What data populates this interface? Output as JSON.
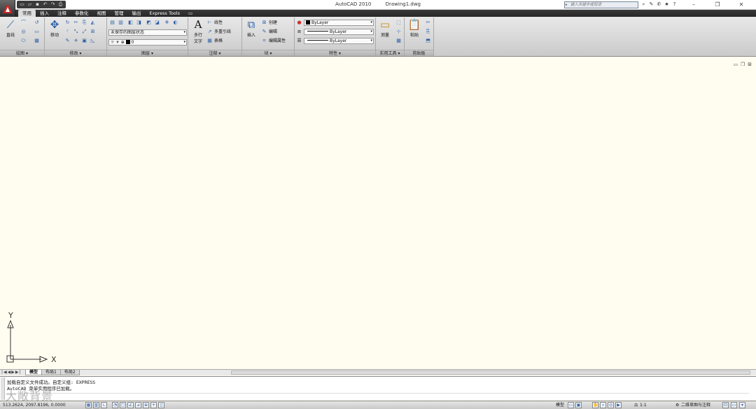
{
  "title_bar": {
    "app_name": "AutoCAD 2010",
    "document": "Drawing1.dwg",
    "search_placeholder": "键入关键字或短语",
    "qat_icons": [
      "new-icon",
      "open-icon",
      "save-icon",
      "undo-icon",
      "redo-icon",
      "plot-icon"
    ],
    "window_controls": [
      "minimize-icon",
      "restore-icon",
      "close-icon"
    ]
  },
  "ribbon_tabs": [
    "常用",
    "插入",
    "注释",
    "参数化",
    "视图",
    "管理",
    "输出",
    "Express Tools"
  ],
  "ribbon": {
    "draw": {
      "title": "绘图 ▾",
      "line_label": "直线"
    },
    "modify": {
      "title": "修改 ▾",
      "move_label": "移动"
    },
    "layers": {
      "title": "图层 ▾",
      "layer_state": "未保存的图层状态",
      "current_layer": "0"
    },
    "annotation": {
      "title": "注释 ▾",
      "multiline_text": "多行",
      "text_label": "文字",
      "linear": "线性",
      "mleader": "多重引线",
      "table": "表格"
    },
    "block": {
      "title": "块 ▾",
      "insert": "插入",
      "create": "创建",
      "edit": "编辑",
      "edit_attributes": "编辑属性"
    },
    "properties": {
      "title": "特性 ▾",
      "color": "ByLayer",
      "linetype": "ByLayer",
      "lineweight": "ByLayer"
    },
    "utilities": {
      "title": "实用工具 ▾",
      "measure": "测量"
    },
    "clipboard": {
      "title": "剪贴板",
      "paste": "粘贴"
    }
  },
  "ucs": {
    "x_label": "X",
    "y_label": "Y"
  },
  "layout_tabs": [
    "模型",
    "布局1",
    "布局2"
  ],
  "command": {
    "lines": [
      "加载自定义文件成功。自定义组: EXPRESS",
      "AutoCAD 菜单实用程序已加载。"
    ],
    "watermark": "大敞背景"
  },
  "status": {
    "coordinates": "513.2624,  2097.8196,  0.0000",
    "model_label": "模型",
    "scale": "1:1",
    "workspace": "二维草图与注释"
  },
  "colors": {
    "accent": "#2b5fa8",
    "canvas": "#fffdf0",
    "tab_bar": "#2a2a2a"
  }
}
